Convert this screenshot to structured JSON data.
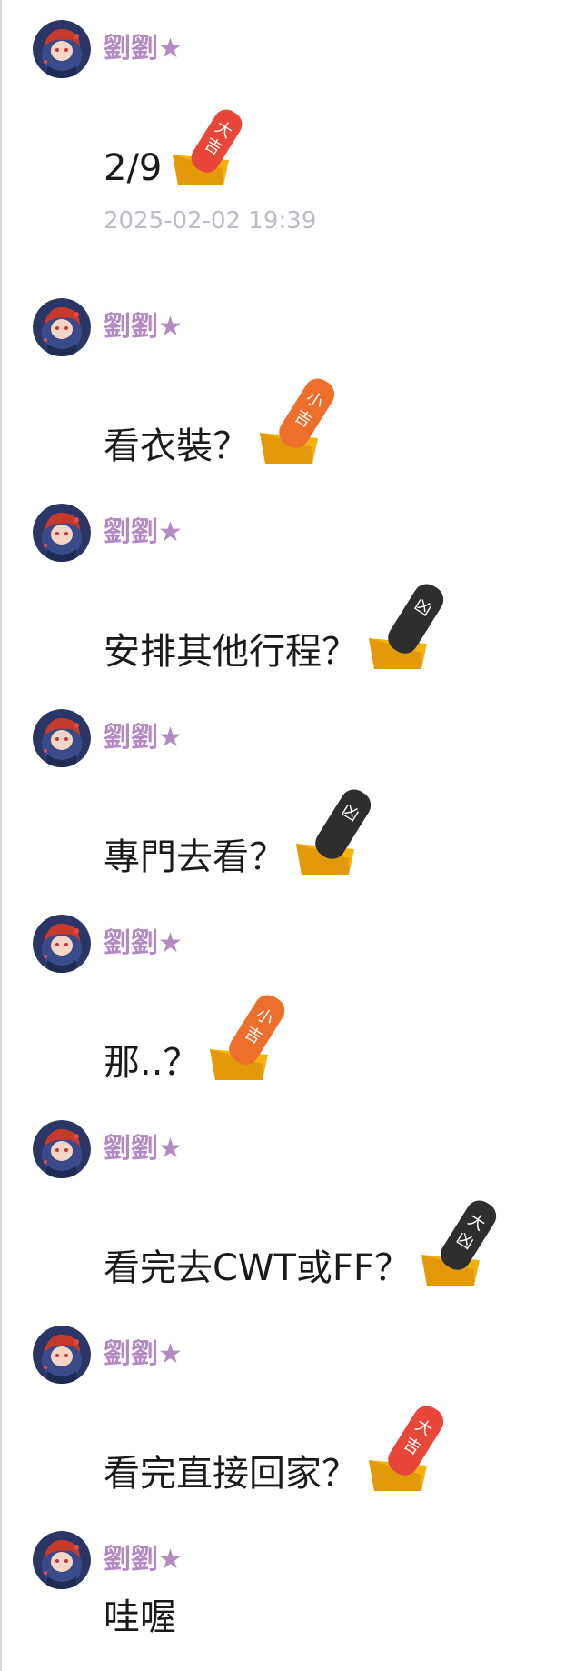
{
  "sender_name": "劉劉★",
  "messages": [
    {
      "text": "2/9",
      "stamp": {
        "type": "daikichi",
        "color": "#e9463a",
        "label": "大吉"
      },
      "time": "2025-02-02 19:39"
    },
    {
      "text": "看衣裝？",
      "stamp": {
        "type": "shokichi",
        "color": "#ee6e2c",
        "label": "小吉"
      }
    },
    {
      "text": "安排其他行程？",
      "stamp": {
        "type": "kyo",
        "color": "#2e2e2e",
        "label": "凶"
      }
    },
    {
      "text": "專門去看？",
      "stamp": {
        "type": "kyo",
        "color": "#2e2e2e",
        "label": "凶"
      }
    },
    {
      "text": "那..？",
      "stamp": {
        "type": "shokichi",
        "color": "#ee6e2c",
        "label": "小吉"
      }
    },
    {
      "text": "看完去CWT或FF？",
      "stamp": {
        "type": "daikyo",
        "color": "#2e2e2e",
        "label": "大凶"
      }
    },
    {
      "text": "看完直接回家？",
      "stamp": {
        "type": "daikichi",
        "color": "#e9463a",
        "label": "大吉"
      }
    },
    {
      "text": "哇喔"
    }
  ],
  "colors": {
    "sender": "#b38ac4",
    "timestamp": "#b9bec6",
    "stamp_base": "#f2b20f"
  }
}
